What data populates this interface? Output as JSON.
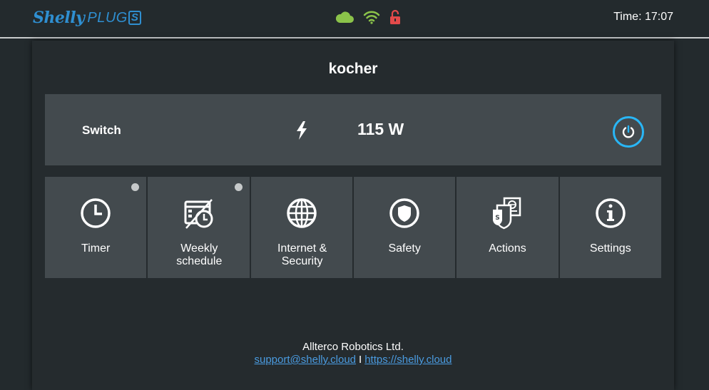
{
  "header": {
    "logo_brand": "Shelly",
    "logo_product": "PLUG",
    "logo_badge": "S",
    "time": "Time: 17:07",
    "status_icons": [
      "cloud-icon",
      "wifi-icon",
      "unlocked-icon"
    ],
    "colors": {
      "cloud": "#8bc34a",
      "wifi": "#8bc34a",
      "lock": "#e24a4a",
      "brand": "#2f8fd1"
    }
  },
  "device": {
    "name": "kocher",
    "switch_label": "Switch",
    "power": "115 W",
    "power_button_color": "#29b6f6"
  },
  "tiles": [
    {
      "label": "Timer",
      "icon": "clock-icon",
      "indicator": true
    },
    {
      "label": "Weekly schedule",
      "icon": "schedule-icon",
      "indicator": true
    },
    {
      "label": "Internet & Security",
      "icon": "globe-icon",
      "indicator": false
    },
    {
      "label": "Safety",
      "icon": "shield-icon",
      "indicator": false
    },
    {
      "label": "Actions",
      "icon": "actions-icon",
      "indicator": false
    },
    {
      "label": "Settings",
      "icon": "info-icon",
      "indicator": false
    }
  ],
  "footer": {
    "company": "Allterco Robotics Ltd.",
    "email": "support@shelly.cloud",
    "separator": "I",
    "website": "https://shelly.cloud"
  }
}
